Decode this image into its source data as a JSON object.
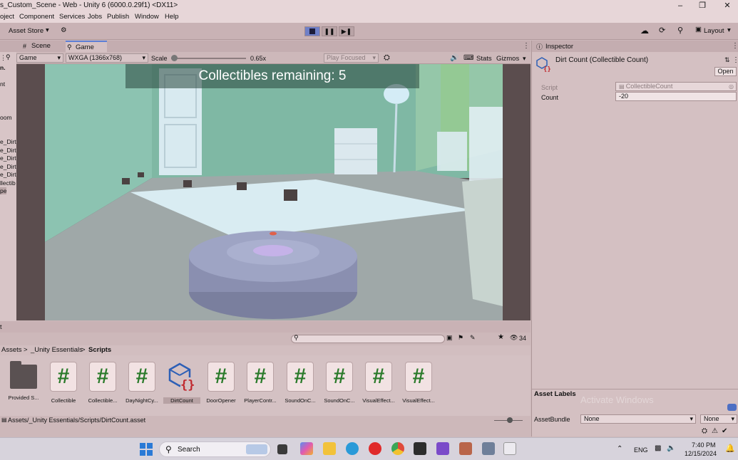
{
  "window": {
    "title": "s_Custom_Scene - Web - Unity 6 (6000.0.29f1) <DX11>"
  },
  "menu": [
    "oject",
    "Component",
    "Services",
    "Jobs",
    "Publish",
    "Window",
    "Help"
  ],
  "toolbar": {
    "asset_store": "Asset Store",
    "layout": "Layout"
  },
  "tabs": [
    "Scene",
    "Game"
  ],
  "game_bar": {
    "display": "Game",
    "resolution": "WXGA (1366x768)",
    "scale_label": "Scale",
    "scale_value": "0.65x",
    "play_mode": "Play Focused",
    "stats": "Stats",
    "gizmos": "Gizmos"
  },
  "game_view": {
    "banner": "Collectibles remaining: 5"
  },
  "left_strip": [
    "n.",
    "nt",
    "oom",
    "e_Dirt",
    "e_Dirt",
    "e_Dirt",
    "e_Dirt",
    "e_Dirt",
    "llectib",
    "pe"
  ],
  "inspector": {
    "tab": "Inspector",
    "component": "Dirt Count (Collectible Count)",
    "open_button": "Open",
    "script_label": "Script",
    "script_value": "CollectibleCount",
    "count_label": "Count",
    "count_value": "-20",
    "asset_labels": "Asset Labels",
    "asset_bundle_label": "AssetBundle",
    "asset_bundle_value": "None",
    "asset_bundle_variant": "None"
  },
  "project": {
    "left_label": "t",
    "breadcrumb": [
      "Assets",
      "_Unity Essentials",
      "Scripts"
    ],
    "visible_count": "34",
    "assets": [
      {
        "name": "Provided S...",
        "kind": "folder"
      },
      {
        "name": "Collectible",
        "kind": "script"
      },
      {
        "name": "Collectible...",
        "kind": "script"
      },
      {
        "name": "DayNightCy...",
        "kind": "script"
      },
      {
        "name": "DirtCount",
        "kind": "scriptable"
      },
      {
        "name": "DoorOpener",
        "kind": "script"
      },
      {
        "name": "PlayerContr...",
        "kind": "script"
      },
      {
        "name": "SoundOnC...",
        "kind": "script"
      },
      {
        "name": "SoundOnC...",
        "kind": "script"
      },
      {
        "name": "VisualEffect...",
        "kind": "script"
      },
      {
        "name": "VisualEffect...",
        "kind": "script"
      }
    ],
    "status_path": "Assets/_Unity Essentials/Scripts/DirtCount.asset"
  },
  "taskbar": {
    "search_placeholder": "Search",
    "lang": "ENG",
    "time": "7:40 PM",
    "date": "12/15/2024"
  },
  "watermark": "Activate Windows",
  "colors": {
    "accent": "#5d7fd6",
    "script_icon": "#2a7a2a",
    "play_active": "#6f7fc7"
  }
}
